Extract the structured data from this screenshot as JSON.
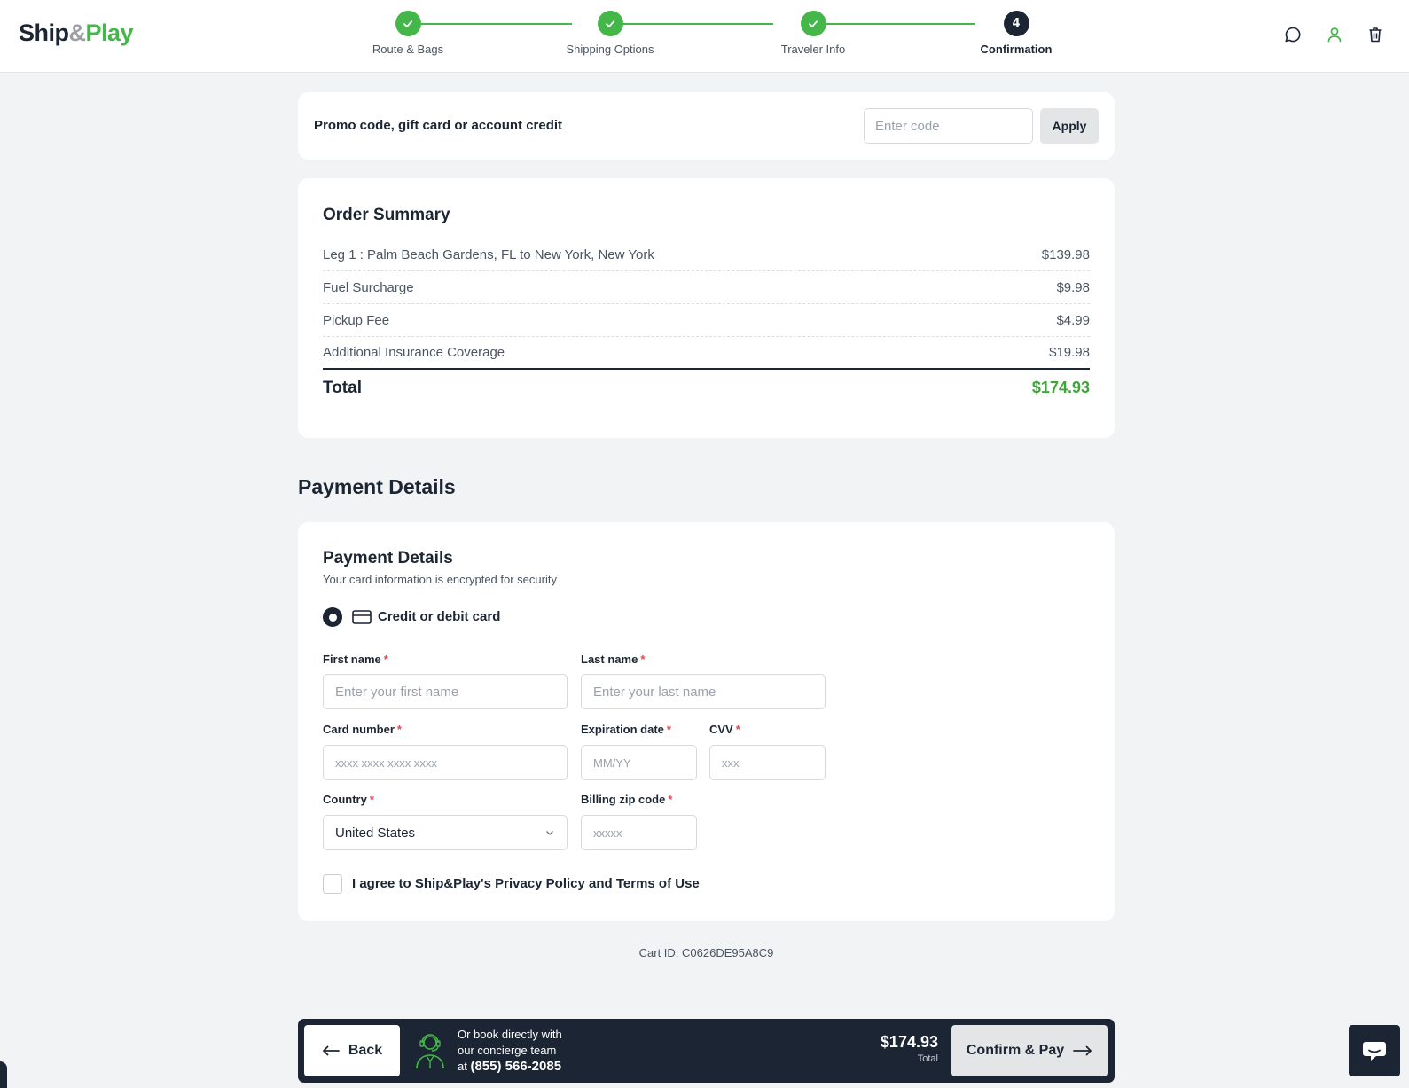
{
  "brand": {
    "ship": "Ship",
    "amp": "&",
    "play": "Play"
  },
  "steps": [
    {
      "label": "Route & Bags",
      "state": "complete"
    },
    {
      "label": "Shipping Options",
      "state": "complete"
    },
    {
      "label": "Traveler Info",
      "state": "complete"
    },
    {
      "label": "Confirmation",
      "state": "active",
      "number": "4"
    }
  ],
  "header_icons": [
    "chat-icon",
    "user-icon",
    "trash-icon"
  ],
  "promo": {
    "label": "Promo code, gift card or account credit",
    "placeholder": "Enter code",
    "apply_label": "Apply"
  },
  "order_summary": {
    "title": "Order Summary",
    "rows": [
      {
        "label": "Leg 1 : Palm Beach Gardens, FL to New York, New York",
        "amount": "$139.98"
      },
      {
        "label": "Fuel Surcharge",
        "amount": "$9.98"
      },
      {
        "label": "Pickup Fee",
        "amount": "$4.99"
      },
      {
        "label": "Additional Insurance Coverage",
        "amount": "$19.98"
      }
    ],
    "total_label": "Total",
    "total_amount": "$174.93"
  },
  "payment_section_title": "Payment Details",
  "payment": {
    "title": "Payment Details",
    "subtitle": "Your card information is encrypted for security",
    "method_label": "Credit or debit card",
    "fields": {
      "first_name": {
        "label": "First name",
        "placeholder": "Enter your first name"
      },
      "last_name": {
        "label": "Last name",
        "placeholder": "Enter your last name"
      },
      "card_number": {
        "label": "Card number",
        "placeholder": "xxxx xxxx xxxx xxxx"
      },
      "expiration": {
        "label": "Expiration date",
        "placeholder": "MM/YY"
      },
      "cvv": {
        "label": "CVV",
        "placeholder": "xxx"
      },
      "country": {
        "label": "Country",
        "value": "United States"
      },
      "zip": {
        "label": "Billing zip code",
        "placeholder": "xxxxx"
      }
    },
    "required_mark": "*",
    "agree_label": "I agree to Ship&Play's Privacy Policy and Terms of Use"
  },
  "cart_id": "Cart ID: C0626DE95A8C9",
  "footer": {
    "back_label": "Back",
    "concierge_line1": "Or book directly with",
    "concierge_line2": "our concierge team",
    "concierge_at": "at",
    "phone": "(855) 566-2085",
    "total_amount": "$174.93",
    "total_caption": "Total",
    "confirm_label": "Confirm & Pay"
  },
  "colors": {
    "accent_green": "#45b649",
    "navy": "#1c2533",
    "required_red": "#e04b4b"
  }
}
